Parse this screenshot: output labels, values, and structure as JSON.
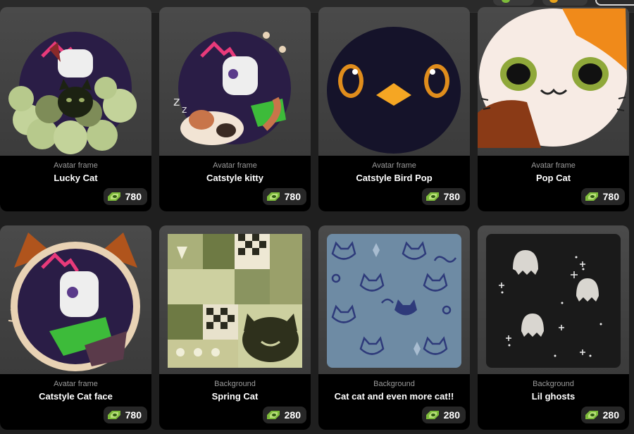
{
  "shop": {
    "items": [
      {
        "type": "Avatar frame",
        "name": "Lucky Cat",
        "price": "780",
        "art": "lucky-cat"
      },
      {
        "type": "Avatar frame",
        "name": "Catstyle kitty",
        "price": "780",
        "art": "catstyle-kitty"
      },
      {
        "type": "Avatar frame",
        "name": "Catstyle Bird Pop",
        "price": "780",
        "art": "bird-pop"
      },
      {
        "type": "Avatar frame",
        "name": "Pop Cat",
        "price": "780",
        "art": "pop-cat"
      },
      {
        "type": "Avatar frame",
        "name": "Catstyle Cat face",
        "price": "780",
        "art": "cat-face"
      },
      {
        "type": "Background",
        "name": "Spring Cat",
        "price": "280",
        "art": "spring-cat"
      },
      {
        "type": "Background",
        "name": "Cat cat and even more cat!!",
        "price": "280",
        "art": "cat-pattern"
      },
      {
        "type": "Background",
        "name": "Lil ghosts",
        "price": "280",
        "art": "lil-ghosts"
      }
    ]
  },
  "colors": {
    "card_bg": "#3d3d3d",
    "info_bg": "#000000",
    "gem_green": "#7dbb3a",
    "price_bg": "#272727"
  }
}
